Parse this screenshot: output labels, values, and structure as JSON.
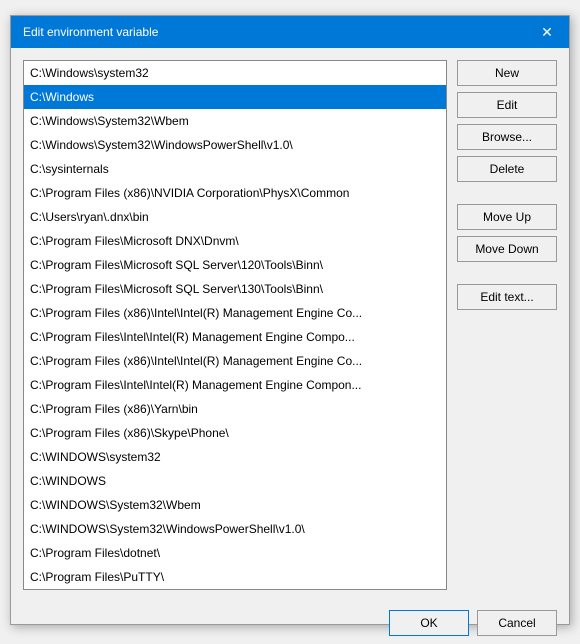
{
  "dialog": {
    "title": "Edit environment variable",
    "close_label": "✕"
  },
  "list": {
    "items": [
      {
        "text": "C:\\Windows\\system32",
        "selected": false
      },
      {
        "text": "C:\\Windows",
        "selected": true
      },
      {
        "text": "C:\\Windows\\System32\\Wbem",
        "selected": false
      },
      {
        "text": "C:\\Windows\\System32\\WindowsPowerShell\\v1.0\\",
        "selected": false
      },
      {
        "text": "C:\\sysinternals",
        "selected": false
      },
      {
        "text": "C:\\Program Files (x86)\\NVIDIA Corporation\\PhysX\\Common",
        "selected": false
      },
      {
        "text": "C:\\Users\\ryan\\.dnx\\bin",
        "selected": false
      },
      {
        "text": "C:\\Program Files\\Microsoft DNX\\Dnvm\\",
        "selected": false
      },
      {
        "text": "C:\\Program Files\\Microsoft SQL Server\\120\\Tools\\Binn\\",
        "selected": false
      },
      {
        "text": "C:\\Program Files\\Microsoft SQL Server\\130\\Tools\\Binn\\",
        "selected": false
      },
      {
        "text": "C:\\Program Files (x86)\\Intel\\Intel(R) Management Engine Co...",
        "selected": false
      },
      {
        "text": "C:\\Program Files\\Intel\\Intel(R) Management Engine Compo...",
        "selected": false
      },
      {
        "text": "C:\\Program Files (x86)\\Intel\\Intel(R) Management Engine Co...",
        "selected": false
      },
      {
        "text": "C:\\Program Files\\Intel\\Intel(R) Management Engine Compon...",
        "selected": false
      },
      {
        "text": "C:\\Program Files (x86)\\Yarn\\bin",
        "selected": false
      },
      {
        "text": "C:\\Program Files (x86)\\Skype\\Phone\\",
        "selected": false
      },
      {
        "text": "C:\\WINDOWS\\system32",
        "selected": false
      },
      {
        "text": "C:\\WINDOWS",
        "selected": false
      },
      {
        "text": "C:\\WINDOWS\\System32\\Wbem",
        "selected": false
      },
      {
        "text": "C:\\WINDOWS\\System32\\WindowsPowerShell\\v1.0\\",
        "selected": false
      },
      {
        "text": "C:\\Program Files\\dotnet\\",
        "selected": false
      },
      {
        "text": "C:\\Program Files\\PuTTY\\",
        "selected": false
      }
    ]
  },
  "buttons": {
    "new_label": "New",
    "edit_label": "Edit",
    "browse_label": "Browse...",
    "delete_label": "Delete",
    "move_up_label": "Move Up",
    "move_down_label": "Move Down",
    "edit_text_label": "Edit text..."
  },
  "footer": {
    "ok_label": "OK",
    "cancel_label": "Cancel"
  }
}
